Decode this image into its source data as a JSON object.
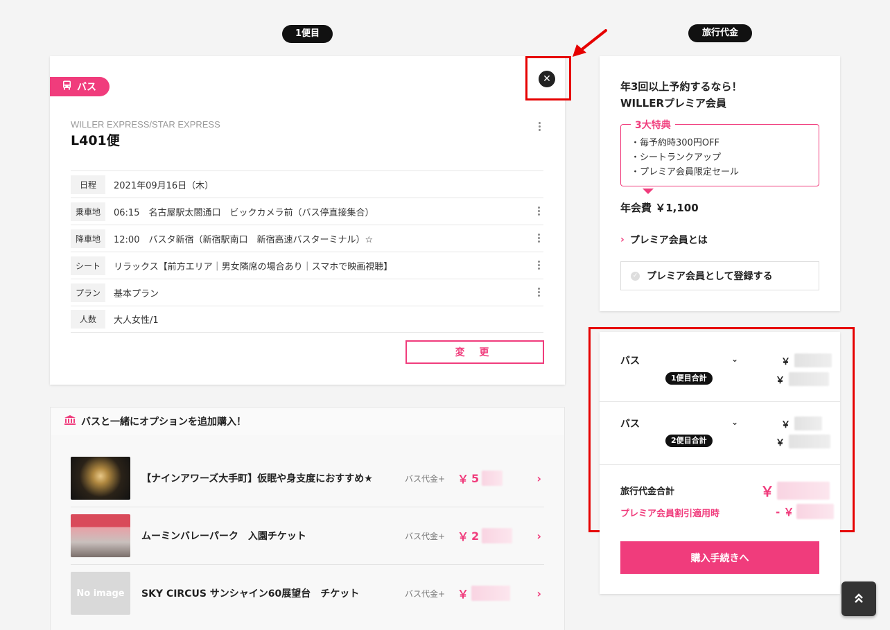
{
  "headers": {
    "trip1": "1便目",
    "fare": "旅行代金"
  },
  "trip": {
    "type_tag": "バス",
    "operator": "WILLER EXPRESS/STAR EXPRESS",
    "flight": "L401便",
    "rows": [
      {
        "label": "日程",
        "value": "2021年09月16日（木）"
      },
      {
        "label": "乗車地",
        "value": "06:15　名古屋駅太閤通口　ビックカメラ前（バス停直接集合）"
      },
      {
        "label": "降車地",
        "value": "12:00　バスタ新宿（新宿駅南口　新宿高速バスターミナル）☆"
      },
      {
        "label": "シート",
        "value": "リラックス【前方エリア｜男女隣席の場合あり｜スマホで映画視聴】"
      },
      {
        "label": "プラン",
        "value": "基本プラン"
      },
      {
        "label": "人数",
        "value": "大人女性/1"
      }
    ],
    "change_button": "変 更"
  },
  "options": {
    "header": "バスと一緒にオプションを追加購入！",
    "items": [
      {
        "title": "【ナインアワーズ大手町】仮眠や身支度におすすめ★",
        "basis": "バス代金+",
        "yen": "￥",
        "price_partial": "5"
      },
      {
        "title": "ムーミンバレーパーク　入園チケット",
        "basis": "バス代金+",
        "yen": "￥",
        "price_partial": "2"
      },
      {
        "title": "SKY CIRCUS サンシャイン60展望台　チケット",
        "basis": "バス代金+",
        "yen": "￥",
        "price_partial": "",
        "thumb_text": "No image"
      }
    ]
  },
  "premium": {
    "title_line1": "年3回以上予約するなら！",
    "title_line2": "WILLERプレミア会員",
    "benefits_title": "3大特典",
    "benefits": [
      "・毎予約時300円OFF",
      "・シートランクアップ",
      "・プレミア会員限定セール"
    ],
    "fee": "年会費 ￥1,100",
    "about_link": "プレミア会員とは",
    "register_button": "プレミア会員として登録する"
  },
  "summary": {
    "legs": [
      {
        "label": "バス",
        "badge": "1便目合計",
        "yen": "￥"
      },
      {
        "label": "バス",
        "badge": "2便目合計",
        "yen": "￥"
      }
    ],
    "total_label": "旅行代金合計",
    "total_yen": "￥",
    "discount_label": "プレミア会員割引適用時",
    "discount_yen": "- ￥",
    "buy_button": "購入手続きへ"
  },
  "colors": {
    "accent": "#f03c7c",
    "highlight": "#e60000"
  },
  "icons": {
    "bus": "bus-icon",
    "close": "close-icon",
    "scroll_top": "double-chevron-up-icon"
  }
}
